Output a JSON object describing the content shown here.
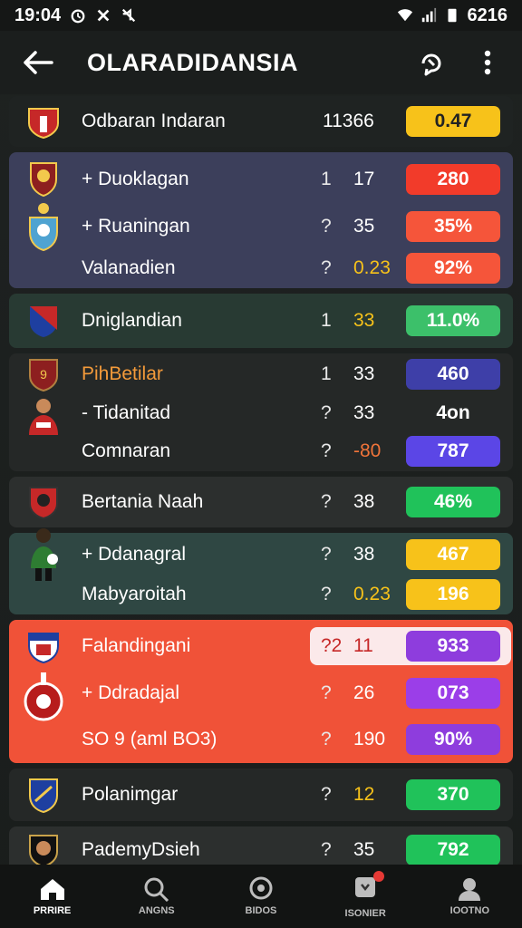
{
  "status": {
    "time": "19:04",
    "battery": "6216"
  },
  "app": {
    "title": "OLARADIDANSIA"
  },
  "rows": [
    {
      "name": "Odbaran Indaran",
      "mid": "",
      "num": "11366",
      "pill": "0.47",
      "pill_color": "#f7c21a",
      "pill_text": "#222"
    },
    {
      "name": "+ Duoklagan",
      "mid": "1",
      "num": "17",
      "pill": "280",
      "pill_color": "#f23b2a",
      "pill_text": "#fff"
    },
    {
      "name": "+ Ruaningan",
      "mid": "?",
      "num": "35",
      "pill": "35%",
      "pill_color": "#f5553a",
      "pill_text": "#fff"
    },
    {
      "name": "Valanadien",
      "mid": "?",
      "num": "0.23",
      "pill": "92%",
      "pill_color": "#f5553a",
      "pill_text": "#fff"
    },
    {
      "name": "Dniglandian",
      "mid": "1",
      "num": "33",
      "pill": "11.0%",
      "pill_color": "#3cc06a",
      "pill_text": "#fff"
    },
    {
      "name": "PihBetilar",
      "mid": "1",
      "num": "33",
      "pill": "460",
      "pill_color": "#3e3fa8",
      "pill_text": "#fff"
    },
    {
      "name": "- Tidanitad",
      "mid": "?",
      "num": "33",
      "pill": "4on",
      "pill_color": "transparent",
      "pill_text": "#fff"
    },
    {
      "name": "Comnaran",
      "mid": "?",
      "num": "-80",
      "pill": "787",
      "pill_color": "#5b46e6",
      "pill_text": "#fff"
    },
    {
      "name": "Bertania Naah",
      "mid": "?",
      "num": "38",
      "pill": "46%",
      "pill_color": "#20c25a",
      "pill_text": "#fff"
    },
    {
      "name": "+ Ddanagral",
      "mid": "?",
      "num": "38",
      "pill": "467",
      "pill_color": "#f7c21a",
      "pill_text": "#fff"
    },
    {
      "name": "Mabyaroitah",
      "mid": "?",
      "num": "0.23",
      "pill": "196",
      "pill_color": "#f7c21a",
      "pill_text": "#fff"
    },
    {
      "name": "Falandingani",
      "mid": "?2",
      "num": "11",
      "pill": "933",
      "pill_color": "#8e3ddd",
      "pill_text": "#fff"
    },
    {
      "name": "+ Ddradajal",
      "mid": "?",
      "num": "26",
      "pill": "073",
      "pill_color": "#9b3ee8",
      "pill_text": "#fff"
    },
    {
      "name": "SO 9 (aml BO3)",
      "mid": "?",
      "num": "190",
      "pill": "90%",
      "pill_color": "#8e3ddd",
      "pill_text": "#fff"
    },
    {
      "name": "Polanimgar",
      "mid": "?",
      "num": "12",
      "pill": "370",
      "pill_color": "#20c25a",
      "pill_text": "#fff"
    },
    {
      "name": "PademyDsieh",
      "mid": "?",
      "num": "35",
      "pill": "792",
      "pill_color": "#20c25a",
      "pill_text": "#fff"
    }
  ],
  "nav": [
    {
      "label": "PRRIRE",
      "icon": "home-icon"
    },
    {
      "label": "ANGNS",
      "icon": "search-icon"
    },
    {
      "label": "BIDOS",
      "icon": "trophy-icon"
    },
    {
      "label": "ISONIER",
      "icon": "notification-icon"
    },
    {
      "label": "IOOTNO",
      "icon": "profile-icon"
    }
  ]
}
